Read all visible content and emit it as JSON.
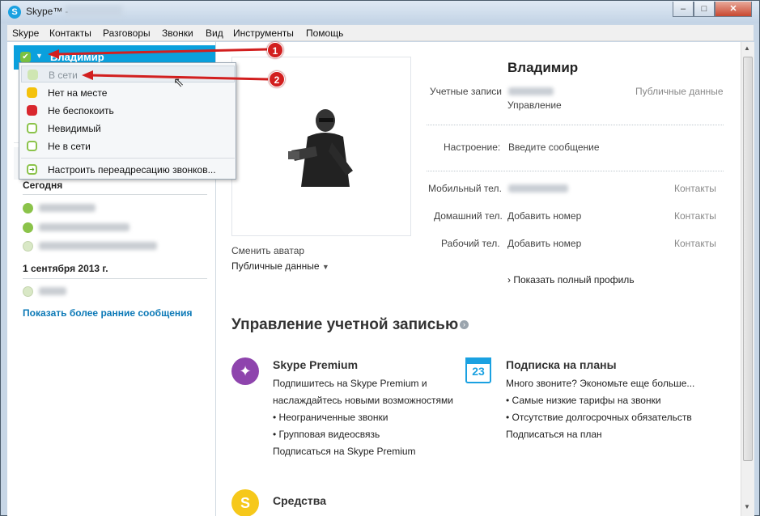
{
  "window": {
    "title": "Skype™ -",
    "min": "‒",
    "max": "□",
    "close": "✕"
  },
  "menu": [
    "Skype",
    "Контакты",
    "Разговоры",
    "Звонки",
    "Вид",
    "Инструменты",
    "Помощь"
  ],
  "sidebar": {
    "user_name": "Владимир",
    "section_today": "Сегодня",
    "section_date": "1 сентября 2013 г.",
    "show_earlier": "Показать более ранние сообщения"
  },
  "status_menu": {
    "items": [
      {
        "label": "В сети",
        "icon": "online-icon",
        "color": "#8bc34a"
      },
      {
        "label": "Нет на месте",
        "icon": "away-icon",
        "color": "#f4c20d"
      },
      {
        "label": "Не беспокоить",
        "icon": "dnd-icon",
        "color": "#d9272e"
      },
      {
        "label": "Невидимый",
        "icon": "invisible-icon",
        "color": "#8bc34a"
      },
      {
        "label": "Не в сети",
        "icon": "offline-icon",
        "color": "#8bc34a"
      }
    ],
    "forwarding": "Настроить переадресацию звонков..."
  },
  "profile": {
    "name": "Владимир",
    "accounts_label": "Учетные записи",
    "manage": "Управление",
    "public_data": "Публичные данные",
    "mood_label": "Настроение:",
    "mood_placeholder": "Введите сообщение",
    "mobile_label": "Мобильный тел.",
    "home_label": "Домашний тел.",
    "work_label": "Рабочий тел.",
    "add_number": "Добавить номер",
    "contacts": "Контакты",
    "full_profile": "Показать полный профиль",
    "change_avatar": "Сменить аватар",
    "public_data_menu": "Публичные данные"
  },
  "account": {
    "title": "Управление учетной записью",
    "premium": {
      "title": "Skype Premium",
      "lines": [
        "Подпишитесь на Skype Premium и",
        "наслаждайтесь новыми возможностями",
        "• Неограниченные звонки",
        "• Групповая видеосвязь"
      ],
      "link": "Подписаться на Skype Premium"
    },
    "plans": {
      "title": "Подписка на планы",
      "icon_text": "23",
      "lines": [
        "Много звоните? Экономьте еще больше...",
        "• Самые низкие тарифы на звонки",
        "• Отсутствие долгосрочных обязательств"
      ],
      "link": "Подписаться на план"
    },
    "credit": {
      "title": "Средства",
      "icon_text": "S"
    }
  },
  "annotations": [
    "1",
    "2"
  ],
  "colors": {
    "skype_blue": "#0aa0dd",
    "link": "#0a78b6",
    "arrow": "#d21f1f",
    "premium": "#8e44ad"
  }
}
